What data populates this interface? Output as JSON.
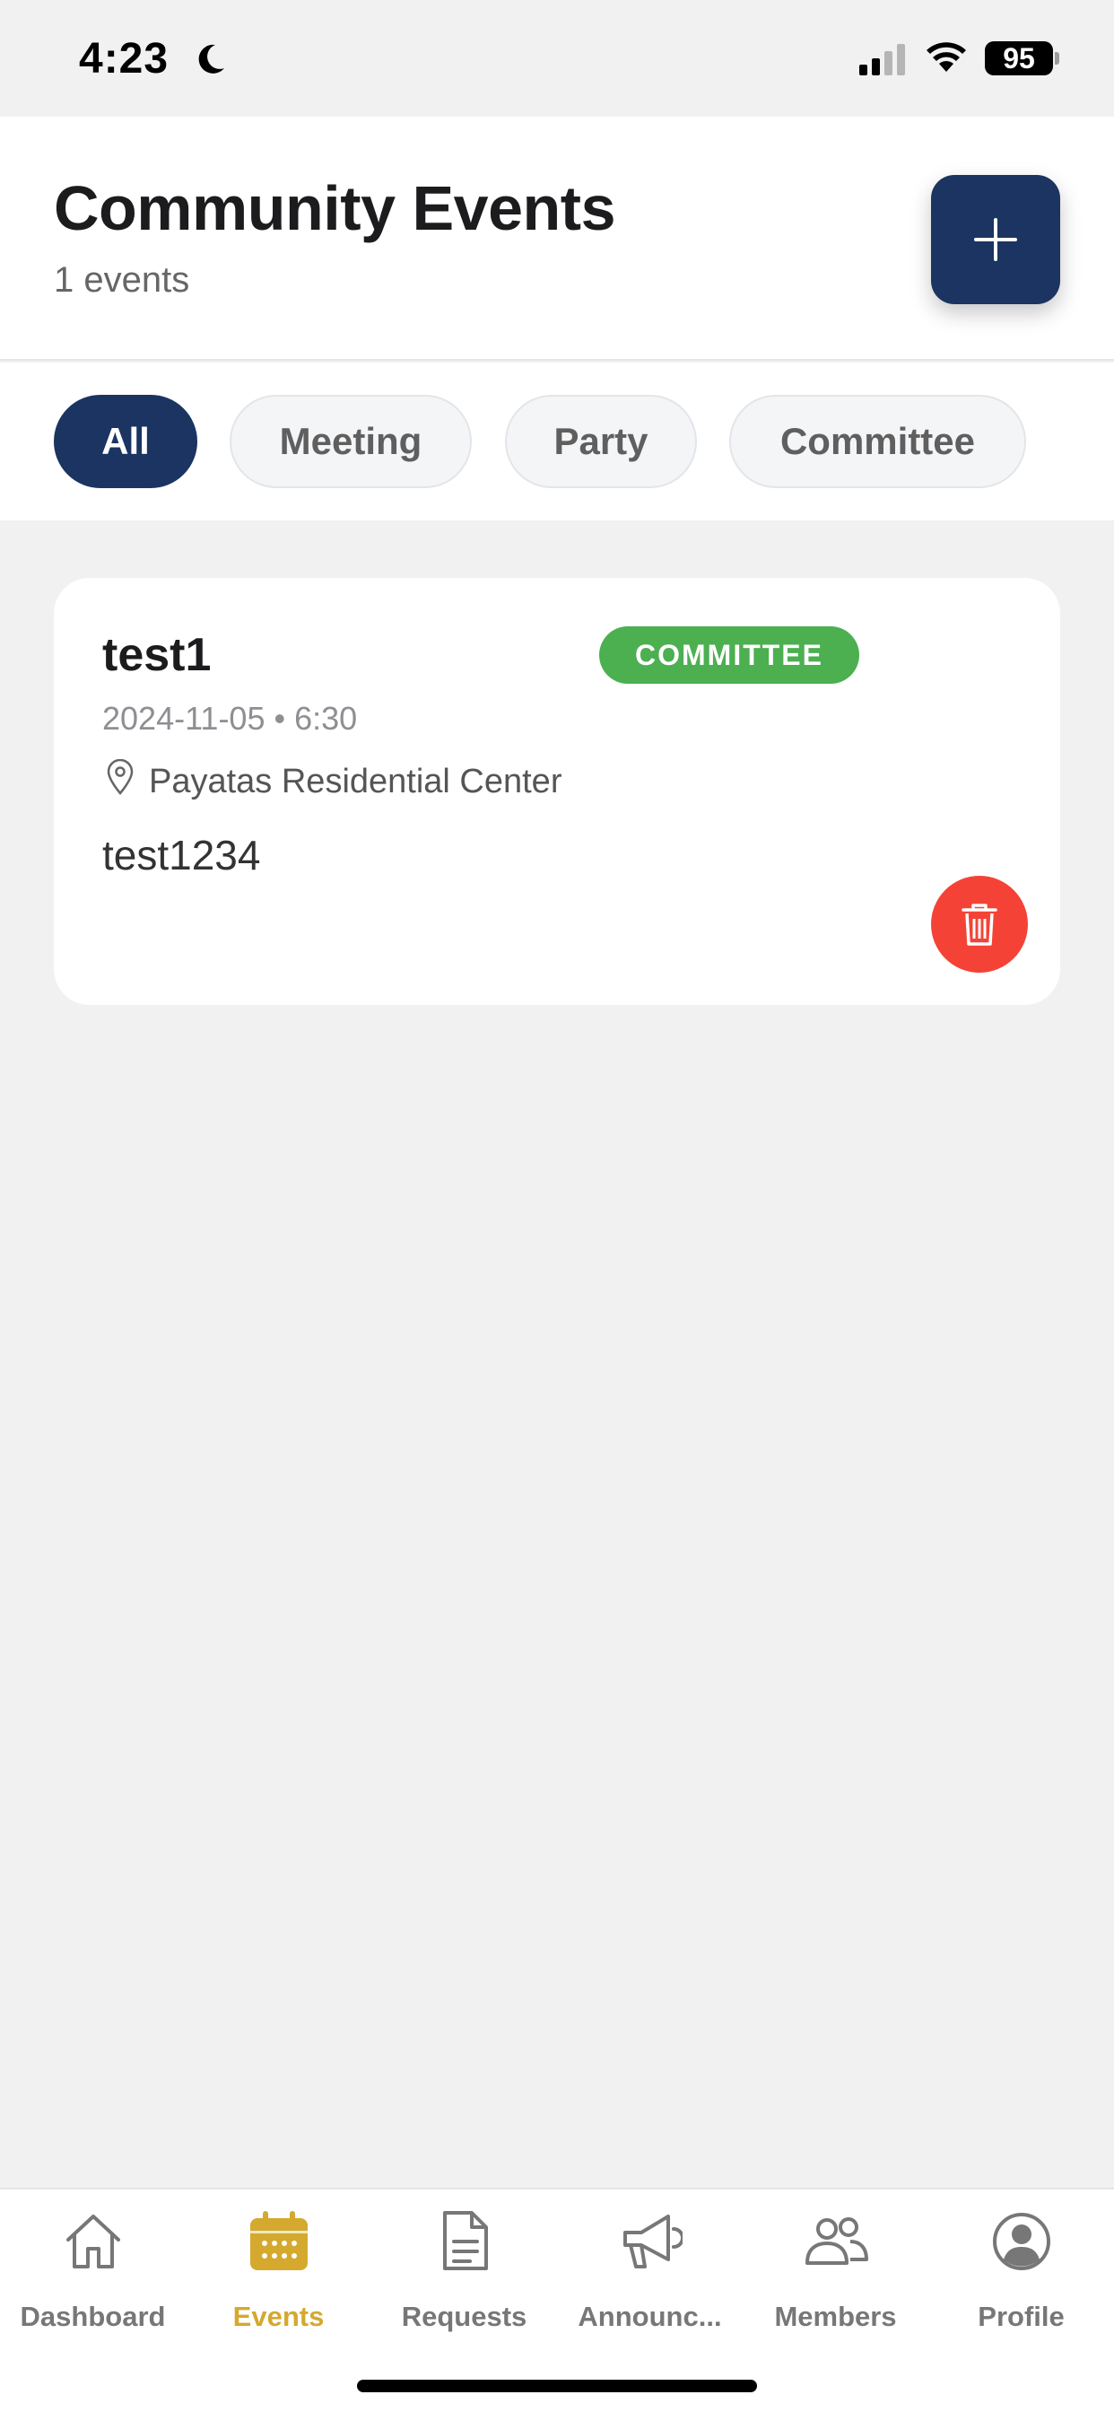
{
  "status_bar": {
    "time": "4:23",
    "battery": "95"
  },
  "header": {
    "title": "Community Events",
    "subtitle": "1 events",
    "add_icon": "plus-icon"
  },
  "filters": [
    {
      "label": "All",
      "active": true
    },
    {
      "label": "Meeting",
      "active": false
    },
    {
      "label": "Party",
      "active": false
    },
    {
      "label": "Committee",
      "active": false
    }
  ],
  "events": [
    {
      "title": "test1",
      "category": "COMMITTEE",
      "datetime": "2024-11-05 • 6:30",
      "location": "Payatas Residential Center",
      "description": "test1234",
      "delete_icon": "trash-icon"
    }
  ],
  "tab_bar": [
    {
      "label": "Dashboard",
      "icon": "home-icon",
      "active": false
    },
    {
      "label": "Events",
      "icon": "calendar-icon",
      "active": true
    },
    {
      "label": "Requests",
      "icon": "document-icon",
      "active": false
    },
    {
      "label": "Announc...",
      "icon": "megaphone-icon",
      "active": false
    },
    {
      "label": "Members",
      "icon": "members-icon",
      "active": false
    },
    {
      "label": "Profile",
      "icon": "profile-icon",
      "active": false
    }
  ],
  "colors": {
    "primary": "#1b3461",
    "accent": "#d4a92e",
    "badge_committee": "#4caf50",
    "danger": "#f44336"
  }
}
